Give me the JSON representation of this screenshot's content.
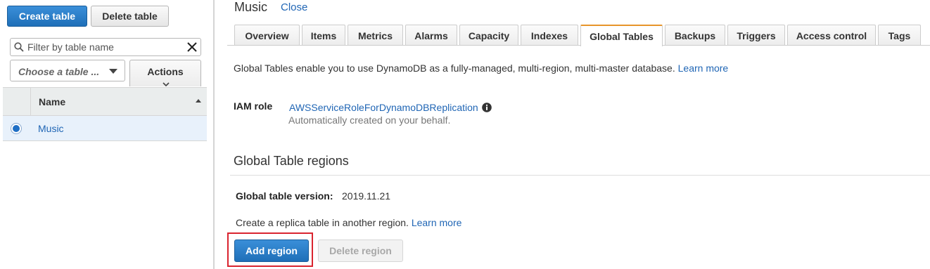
{
  "sidebar": {
    "create_table_label": "Create table",
    "delete_table_label": "Delete table",
    "filter": {
      "placeholder": "Filter by table name",
      "value": ""
    },
    "choose_table_label": "Choose a table ...",
    "actions_label": "Actions",
    "table": {
      "header_name": "Name",
      "rows": [
        {
          "name": "Music",
          "selected": true
        }
      ]
    }
  },
  "main": {
    "table_name": "Music",
    "close_label": "Close",
    "tabs": [
      {
        "label": "Overview",
        "active": false
      },
      {
        "label": "Items",
        "active": false
      },
      {
        "label": "Metrics",
        "active": false
      },
      {
        "label": "Alarms",
        "active": false
      },
      {
        "label": "Capacity",
        "active": false
      },
      {
        "label": "Indexes",
        "active": false
      },
      {
        "label": "Global Tables",
        "active": true
      },
      {
        "label": "Backups",
        "active": false
      },
      {
        "label": "Triggers",
        "active": false
      },
      {
        "label": "Access control",
        "active": false
      },
      {
        "label": "Tags",
        "active": false
      }
    ],
    "description": "Global Tables enable you to use DynamoDB as a fully-managed, multi-region, multi-master database.",
    "description_link": "Learn more",
    "iam_label": "IAM role",
    "iam_value": "AWSServiceRoleForDynamoDBReplication",
    "iam_help": "Automatically created on your behalf.",
    "regions_title": "Global Table regions",
    "version_label": "Global table version:",
    "version_value": "2019.11.21",
    "replica_text": "Create a replica table in another region.",
    "replica_link": "Learn more",
    "add_region_label": "Add region",
    "delete_region_label": "Delete region"
  },
  "colors": {
    "primary_button": "#1f6fb8",
    "link": "#2066b5",
    "active_tab_accent": "#e7952a",
    "highlight_box": "#d9242f",
    "selected_row": "#e8f1fb"
  }
}
